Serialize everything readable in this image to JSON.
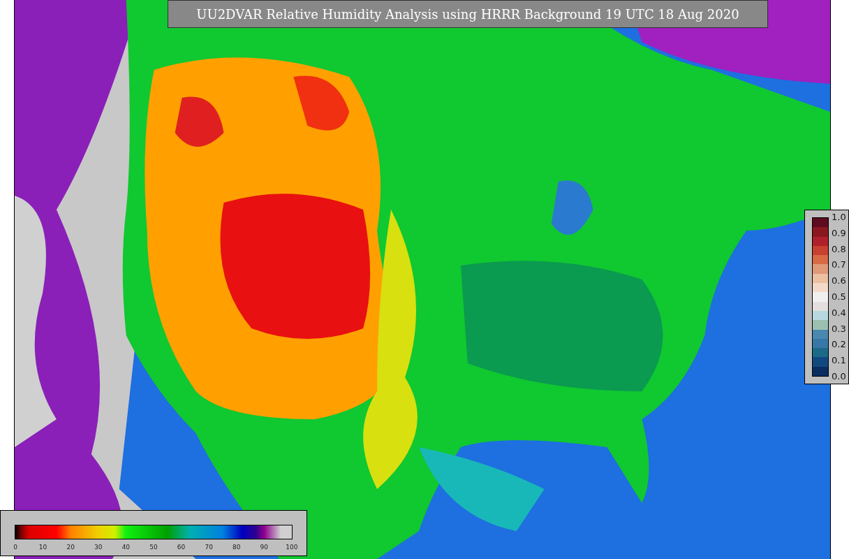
{
  "title": "UU2DVAR Relative Humidity Analysis using HRRR Background 19 UTC 18 Aug 2020",
  "side_colorbar": {
    "ticks": [
      "1.0",
      "0.9",
      "0.8",
      "0.7",
      "0.6",
      "0.5",
      "0.4",
      "0.3",
      "0.2",
      "0.1",
      "0.0"
    ]
  },
  "bottom_colorbar": {
    "ticks": [
      "0",
      "10",
      "20",
      "30",
      "40",
      "50",
      "60",
      "70",
      "80",
      "90",
      "100"
    ]
  }
}
